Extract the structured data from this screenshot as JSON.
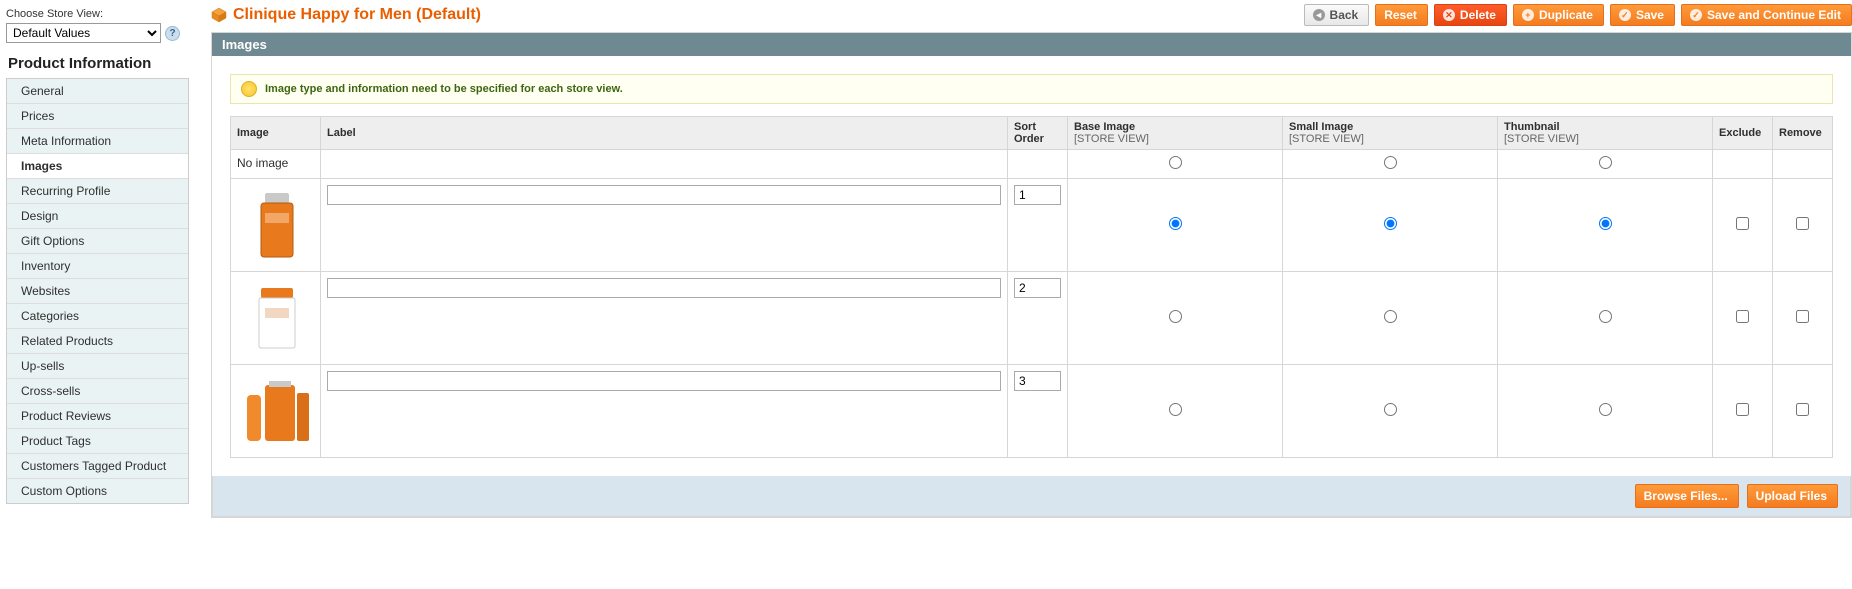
{
  "sidebar": {
    "store_switcher_label": "Choose Store View:",
    "store_switcher_value": "Default Values",
    "section_title": "Product Information",
    "tabs": [
      {
        "label": "General",
        "active": false
      },
      {
        "label": "Prices",
        "active": false
      },
      {
        "label": "Meta Information",
        "active": false
      },
      {
        "label": "Images",
        "active": true
      },
      {
        "label": "Recurring Profile",
        "active": false
      },
      {
        "label": "Design",
        "active": false
      },
      {
        "label": "Gift Options",
        "active": false
      },
      {
        "label": "Inventory",
        "active": false
      },
      {
        "label": "Websites",
        "active": false
      },
      {
        "label": "Categories",
        "active": false
      },
      {
        "label": "Related Products",
        "active": false
      },
      {
        "label": "Up-sells",
        "active": false
      },
      {
        "label": "Cross-sells",
        "active": false
      },
      {
        "label": "Product Reviews",
        "active": false
      },
      {
        "label": "Product Tags",
        "active": false
      },
      {
        "label": "Customers Tagged Product",
        "active": false
      },
      {
        "label": "Custom Options",
        "active": false
      }
    ]
  },
  "header": {
    "title": "Clinique Happy for Men (Default)",
    "buttons": {
      "back": "Back",
      "reset": "Reset",
      "delete": "Delete",
      "duplicate": "Duplicate",
      "save": "Save",
      "save_continue": "Save and Continue Edit"
    }
  },
  "panel": {
    "title": "Images",
    "notice": "Image type and information need to be specified for each store view.",
    "scope_label": "[STORE VIEW]",
    "columns": {
      "image": "Image",
      "label": "Label",
      "sort_order": "Sort Order",
      "base_image": "Base Image",
      "small_image": "Small Image",
      "thumbnail": "Thumbnail",
      "exclude": "Exclude",
      "remove": "Remove"
    },
    "no_image_label": "No image",
    "rows": [
      {
        "label_value": "",
        "sort_order": "1",
        "base": true,
        "small": true,
        "thumb": true,
        "exclude": false,
        "remove": false
      },
      {
        "label_value": "",
        "sort_order": "2",
        "base": false,
        "small": false,
        "thumb": false,
        "exclude": false,
        "remove": false
      },
      {
        "label_value": "",
        "sort_order": "3",
        "base": false,
        "small": false,
        "thumb": false,
        "exclude": false,
        "remove": false
      }
    ],
    "upload": {
      "browse": "Browse Files...",
      "upload": "Upload Files"
    }
  }
}
